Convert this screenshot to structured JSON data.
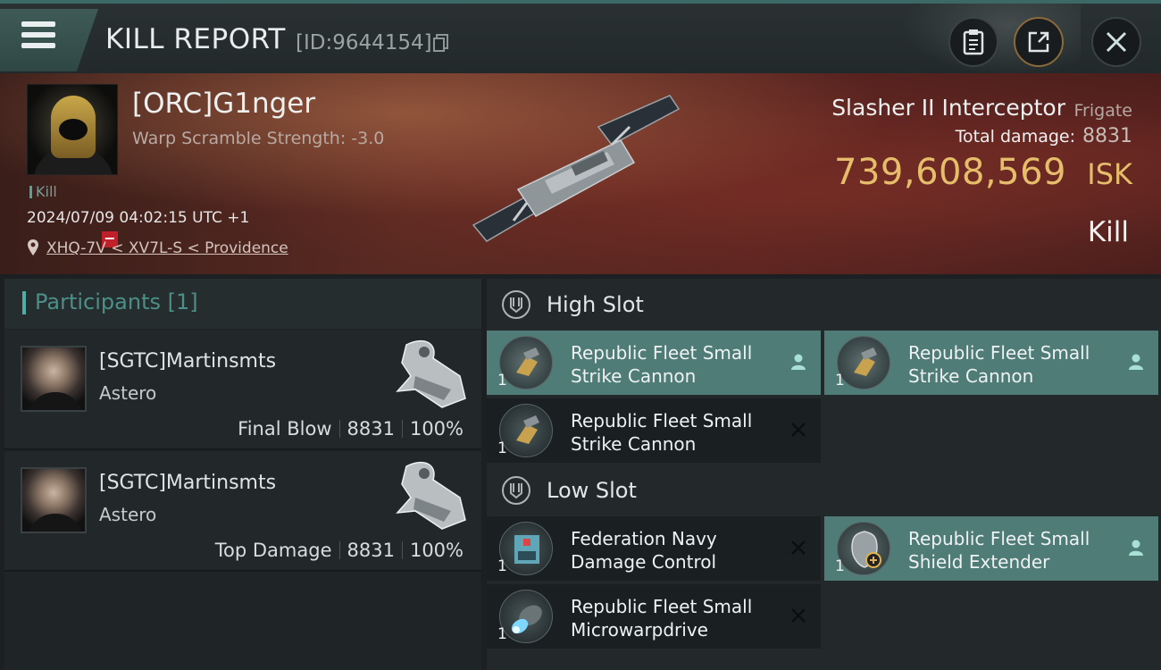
{
  "header": {
    "title": "KILL REPORT",
    "report_id": "[ID:9644154]"
  },
  "victim": {
    "pilot_name": "[ORC]G1nger",
    "warp_scramble": "Warp Scramble Strength: -3.0",
    "tag": "Kill",
    "timestamp": "2024/07/09 04:02:15 UTC +1",
    "location": "XHQ-7V < XV7L-S < Providence",
    "ship_name": "Slasher II Interceptor",
    "ship_class": "Frigate",
    "total_damage_label": "Total damage:",
    "total_damage": "8831",
    "isk_value": "739,608,569",
    "isk_label": "ISK",
    "result": "Kill"
  },
  "participants": {
    "heading": "Participants [1]",
    "rows": [
      {
        "name": "[SGTC]Martinsmts",
        "ship": "Astero",
        "role": "Final Blow",
        "damage": "8831",
        "percent": "100%"
      },
      {
        "name": "[SGTC]Martinsmts",
        "ship": "Astero",
        "role": "Top Damage",
        "damage": "8831",
        "percent": "100%"
      }
    ]
  },
  "slots": {
    "high_label": "High Slot",
    "low_label": "Low Slot",
    "high": [
      {
        "line1": "Republic Fleet Small",
        "line2": "Strike Cannon",
        "qty": "1",
        "state": "fitted",
        "icon": "cannon-icon"
      },
      {
        "line1": "Republic Fleet Small",
        "line2": "Strike Cannon",
        "qty": "1",
        "state": "fitted",
        "icon": "cannon-icon"
      },
      {
        "line1": "Republic Fleet Small",
        "line2": "Strike Cannon",
        "qty": "1",
        "state": "destroyed",
        "icon": "cannon-icon"
      }
    ],
    "low": [
      {
        "line1": "Federation Navy",
        "line2": "Damage Control",
        "qty": "1",
        "state": "destroyed",
        "icon": "damage-control-icon"
      },
      {
        "line1": "Republic Fleet Small",
        "line2": "Shield Extender",
        "qty": "1",
        "state": "fitted",
        "icon": "shield-extender-icon"
      },
      {
        "line1": "Republic Fleet Small",
        "line2": "Microwarpdrive",
        "qty": "1",
        "state": "destroyed",
        "icon": "microwarpdrive-icon"
      }
    ]
  },
  "colors": {
    "accent_teal": "#4db0a4",
    "isk_gold": "#e6bd6a",
    "fitted_bg": "#4f7c77",
    "badge_red": "#c0202a"
  }
}
